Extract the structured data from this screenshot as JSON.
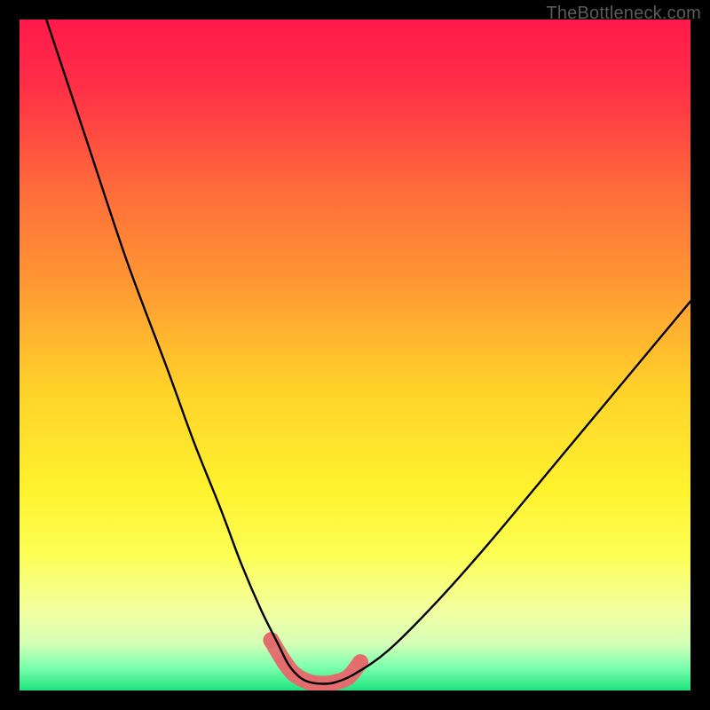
{
  "watermark": "TheBottleneck.com",
  "gradient_stops": [
    {
      "offset": 0.0,
      "color": "#ff1a4b"
    },
    {
      "offset": 0.1,
      "color": "#ff2f47"
    },
    {
      "offset": 0.25,
      "color": "#ff6a3b"
    },
    {
      "offset": 0.4,
      "color": "#ff9a33"
    },
    {
      "offset": 0.55,
      "color": "#ffd22a"
    },
    {
      "offset": 0.7,
      "color": "#fff22e"
    },
    {
      "offset": 0.8,
      "color": "#fcff56"
    },
    {
      "offset": 0.88,
      "color": "#f3ffa0"
    },
    {
      "offset": 0.93,
      "color": "#d5ffb8"
    },
    {
      "offset": 0.965,
      "color": "#7dffad"
    },
    {
      "offset": 1.0,
      "color": "#20e47f"
    }
  ],
  "chart_data": {
    "type": "line",
    "title": "",
    "xlabel": "",
    "ylabel": "",
    "xlim": [
      0,
      100
    ],
    "ylim": [
      0,
      100
    ],
    "grid": false,
    "legend": false,
    "series": [
      {
        "name": "bottleneck-curve",
        "x": [
          4,
          10,
          16,
          22,
          26,
          30,
          33,
          36,
          38.5,
          40,
          41.5,
          43,
          45,
          47,
          50,
          55,
          62,
          70,
          80,
          90,
          100
        ],
        "y": [
          100,
          82,
          64,
          48,
          37,
          27,
          19,
          12,
          7,
          4,
          2.2,
          1.3,
          1,
          1.2,
          2.5,
          6,
          13,
          22,
          34,
          46,
          58
        ]
      }
    ],
    "highlight": {
      "name": "valley-floor-markers",
      "color": "#e46c6c",
      "points_x": [
        37.5,
        39.5,
        41,
        43,
        45,
        47,
        49,
        50.8
      ],
      "points_y": [
        7.5,
        4.2,
        2.4,
        1.3,
        1.0,
        1.2,
        2.0,
        4.2
      ],
      "marker_radius_px": 9
    }
  }
}
